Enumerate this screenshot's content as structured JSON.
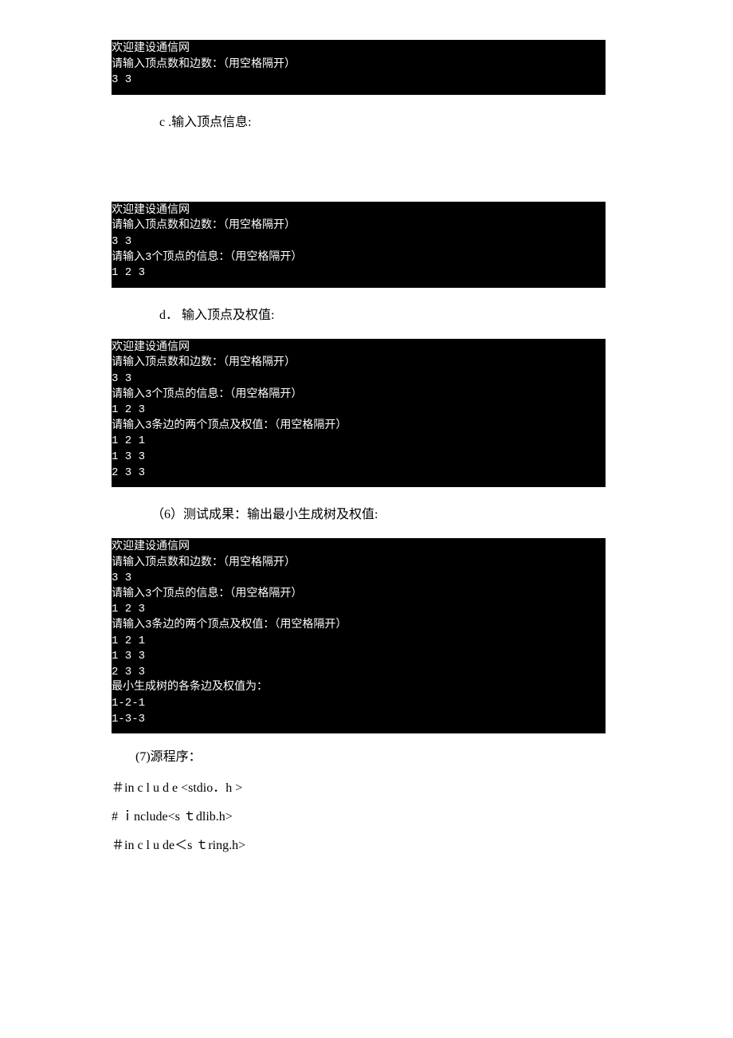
{
  "terminal1": "欢迎建设通信网\n请输入顶点数和边数：（用空格隔开）\n3 3\n",
  "caption_c": "c .输入顶点信息:",
  "terminal2": "欢迎建设通信网\n请输入顶点数和边数：（用空格隔开）\n3 3\n请输入3个顶点的信息：（用空格隔开）\n1 2 3\n",
  "caption_d": "d． 输入顶点及权值:",
  "terminal3": "欢迎建设通信网\n请输入顶点数和边数：（用空格隔开）\n3 3\n请输入3个顶点的信息：（用空格隔开）\n1 2 3\n请输入3条边的两个顶点及权值：（用空格隔开）\n1 2 1\n1 3 3\n2 3 3\n",
  "caption_6": "（6）测试成果：输出最小生成树及权值:",
  "terminal4": "欢迎建设通信网\n请输入顶点数和边数：（用空格隔开）\n3 3\n请输入3个顶点的信息：（用空格隔开）\n1 2 3\n请输入3条边的两个顶点及权值：（用空格隔开）\n1 2 1\n1 3 3\n2 3 3\n最小生成树的各条边及权值为：\n1-2-1\n1-3-3",
  "label_7": "(7)源程序：",
  "code1": "＃in c  l  u d e <stdio．h >",
  "code2": "# ｉnclude<s ｔdlib.h>",
  "code3": "＃in c l u de＜s ｔring.h>"
}
